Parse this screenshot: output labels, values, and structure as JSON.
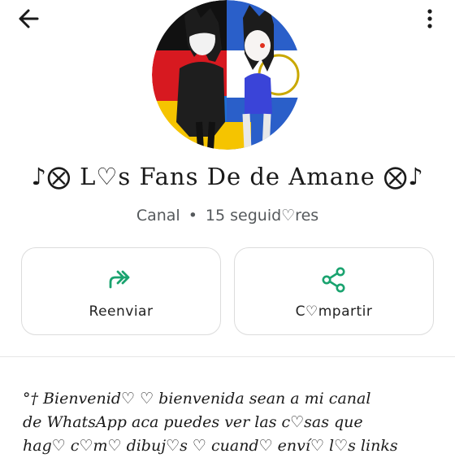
{
  "channel": {
    "name": "♪⨂ L♡s Fans De de Amane ⨂♪",
    "type": "Canal",
    "separator": "•",
    "followers": "15 seguid♡res"
  },
  "actions": {
    "forward_label": "Reenviar",
    "share_label": "C♡mpartir"
  },
  "description": {
    "text": "°† Bienvenid♡ ♡ bienvenida sean a mi canal\nde WhatsApp aca puedes ver las c♡sas que\nhag♡ c♡m♡ dibuj♡s ♡ cuand♡ enví♡ l♡s links"
  },
  "icons": {
    "back": "arrow-left-icon",
    "more": "more-vertical-icon",
    "forward": "double-forward-arrow-icon",
    "share": "share-icon"
  },
  "colors": {
    "accent": "#1aa36f",
    "text": "#1a1a1a",
    "muted": "#55595c"
  }
}
